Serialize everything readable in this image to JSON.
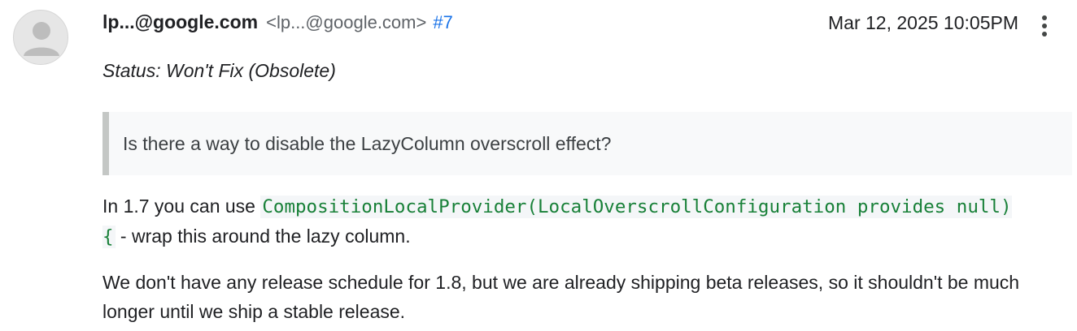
{
  "comment": {
    "author": {
      "name": "lp...@google.com",
      "email": "<lp...@google.com>",
      "avatar_icon": "default-user-avatar"
    },
    "comment_number": "#7",
    "timestamp": "Mar 12, 2025 10:05PM",
    "menu_icon": "more-vert-icon",
    "status_line": "Status: Won't Fix (Obsolete)",
    "quote": "Is there a way to disable the LazyColumn overscroll effect?",
    "paragraph1": {
      "before": "In 1.7 you can use ",
      "code": "CompositionLocalProvider(LocalOverscrollConfiguration provides null) {",
      "after": " - wrap this around the lazy column."
    },
    "paragraph2": "We don't have any release schedule for 1.8, but we are already shipping beta releases, so it shouldn't be much longer until we ship a stable release."
  },
  "colors": {
    "link": "#1a73e8",
    "code": "#188038",
    "quote_bar": "#c4c7c5",
    "quote_bg": "#f8f9fa",
    "text": "#202124",
    "muted": "#5f6368"
  }
}
